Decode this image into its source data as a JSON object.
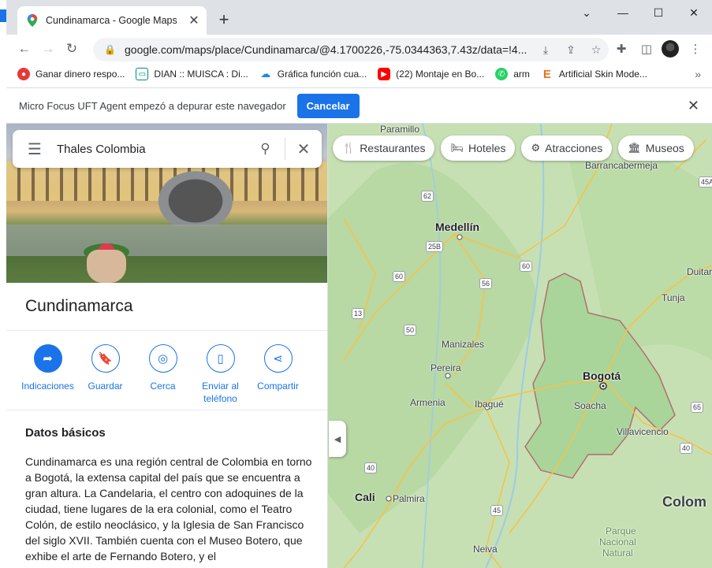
{
  "browser": {
    "tab_title": "Cundinamarca - Google Maps",
    "url_main": "google.com/maps/place/Cundinamarca/@4.1700226,-75.0344363,7.43z/data=!4...",
    "bookmarks": [
      {
        "label": "Ganar dinero respo...",
        "icon": "red-circle-icon",
        "color": "#e53935"
      },
      {
        "label": "DIAN :: MUISCA : Di...",
        "icon": "dian-icon",
        "color": "#00897b"
      },
      {
        "label": "Gráfica función cua...",
        "icon": "cloud-icon",
        "color": "#1e88e5"
      },
      {
        "label": "(22) Montaje en Bo...",
        "icon": "youtube-icon",
        "color": "#ff0000"
      },
      {
        "label": "arm",
        "icon": "whatsapp-icon",
        "color": "#25d366"
      },
      {
        "label": "Artificial Skin Mode...",
        "icon": "elsevier-icon",
        "color": "#e9711c"
      }
    ],
    "infobar_message": "Micro Focus UFT Agent empezó a depurar este navegador",
    "infobar_button": "Cancelar"
  },
  "maps": {
    "search_value": "Thales Colombia",
    "place_title": "Cundinamarca",
    "actions": [
      {
        "label": "Indicaciones",
        "icon": "directions-icon"
      },
      {
        "label": "Guardar",
        "icon": "bookmark-icon"
      },
      {
        "label": "Cerca",
        "icon": "nearby-icon"
      },
      {
        "label": "Enviar al teléfono",
        "icon": "send-to-phone-icon"
      },
      {
        "label": "Compartir",
        "icon": "share-icon"
      }
    ],
    "section_title": "Datos básicos",
    "description": "Cundinamarca es una región central de Colombia en torno a Bogotá, la extensa capital del país que se encuentra a gran altura. La Candelaria, el centro con adoquines de la ciudad, tiene lugares de la era colonial, como el Teatro Colón, de estilo neoclásico, y la Iglesia de San Francisco del siglo XVII. También cuenta con el Museo Botero, que exhibe el arte de Fernando Botero, y el",
    "chips": [
      {
        "label": "Restaurantes",
        "icon": "restaurant-icon"
      },
      {
        "label": "Hoteles",
        "icon": "hotel-icon"
      },
      {
        "label": "Atracciones",
        "icon": "attractions-icon"
      },
      {
        "label": "Museos",
        "icon": "museum-icon"
      }
    ],
    "map_labels": {
      "paramillo": "Paramillo",
      "barrancabermeja": "Barrancabermeja",
      "medellin": "Medellín",
      "duitama": "Duitar",
      "tunja": "Tunja",
      "manizales": "Manizales",
      "pereira": "Pereira",
      "bogota": "Bogotá",
      "armenia": "Armenia",
      "ibague": "Ibagué",
      "soacha": "Soacha",
      "villavicencio": "Villavicencio",
      "cali": "Cali",
      "palmira": "Palmira",
      "colombia": "Colom",
      "neiva": "Neiva",
      "parque": "Parque",
      "nacional": "Nacional",
      "natural": "Natural"
    },
    "road_shields": [
      "62",
      "25B",
      "60",
      "60",
      "56",
      "13",
      "50",
      "45A",
      "65",
      "40",
      "40",
      "45"
    ],
    "colors": {
      "accent": "#1a73e8",
      "land": "#c9e3b8",
      "road": "#f6c344",
      "border": "#b06a6a"
    }
  }
}
